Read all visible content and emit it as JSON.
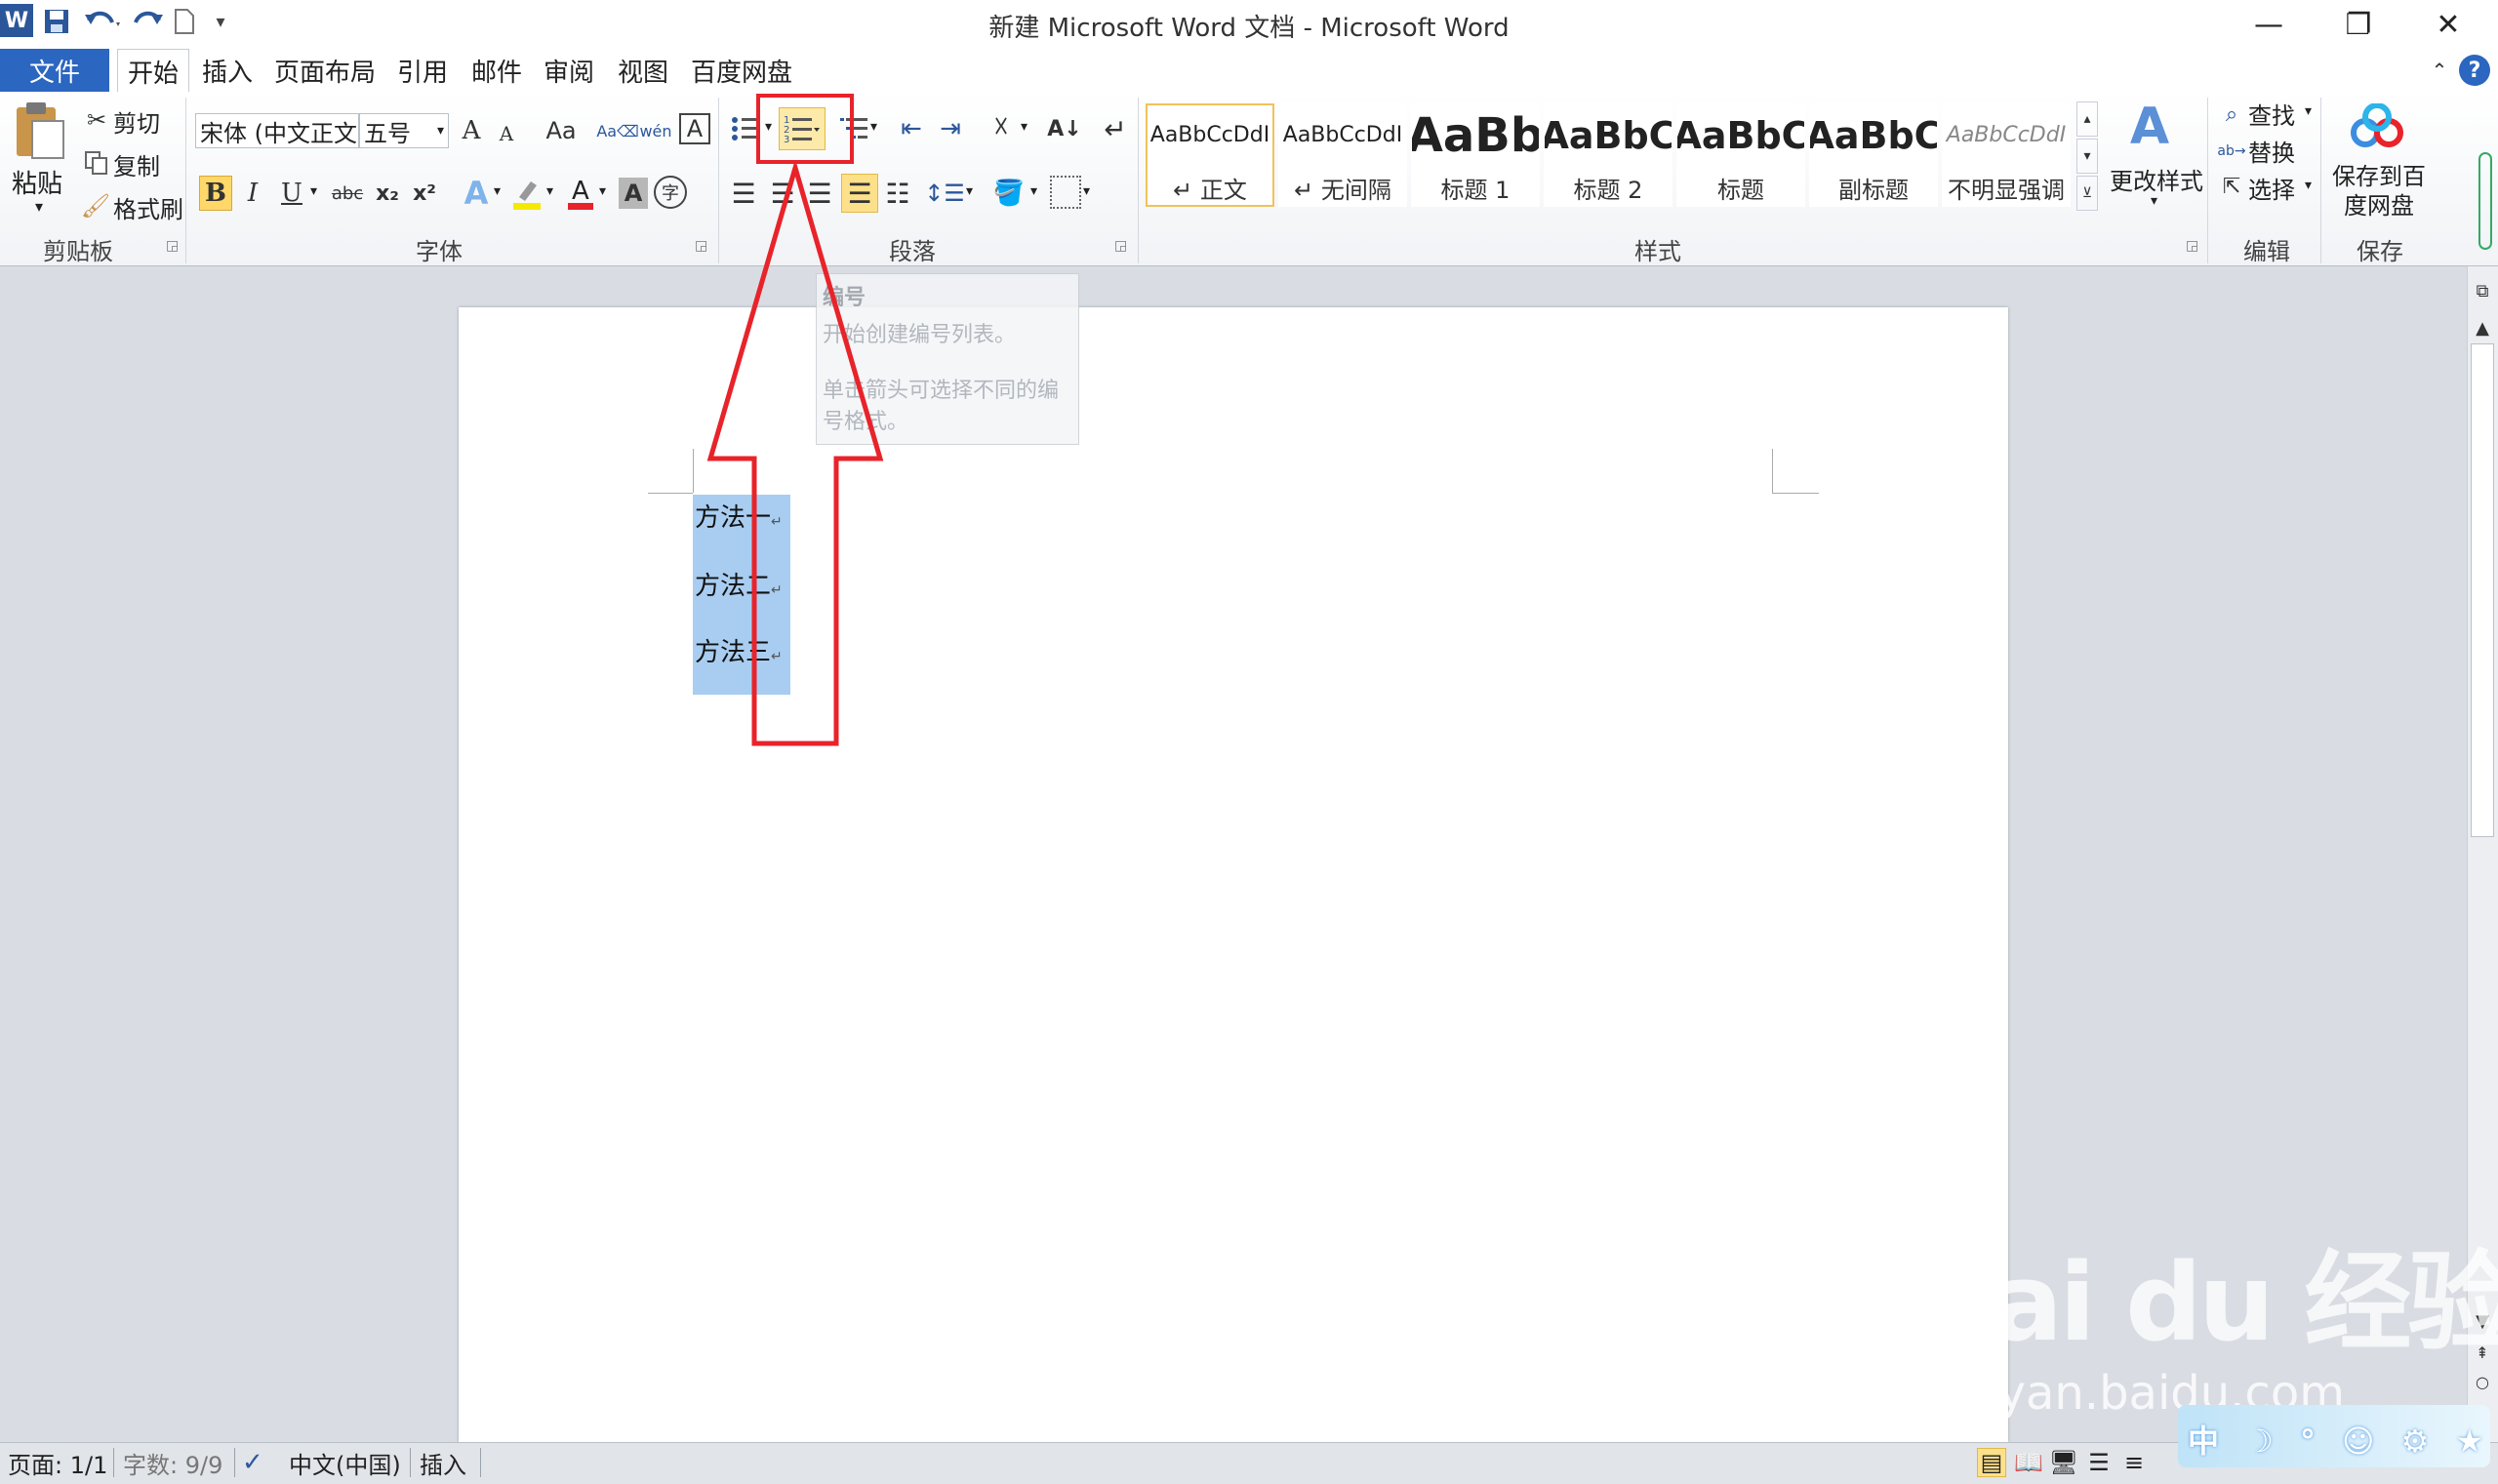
{
  "window": {
    "title": "新建 Microsoft Word 文档 - Microsoft Word",
    "app_icon": "W",
    "minimize": "—",
    "restore": "❐",
    "close": "✕"
  },
  "tabs": [
    "文件",
    "开始",
    "插入",
    "页面布局",
    "引用",
    "邮件",
    "审阅",
    "视图",
    "百度网盘"
  ],
  "clipboard": {
    "paste": "粘贴",
    "cut": "剪切",
    "copy": "复制",
    "format_painter": "格式刷",
    "group": "剪贴板"
  },
  "font": {
    "name": "宋体 (中文正文",
    "size": "五号",
    "group": "字体",
    "grow": "A",
    "shrink": "A",
    "case": "Aa",
    "bold": "B",
    "italic": "I",
    "underline": "U",
    "strike": "abc",
    "subscript": "x₂",
    "superscript": "x²",
    "pinyin": "wén",
    "char_border": "A",
    "effects": "A",
    "shading": "A",
    "circle": "字"
  },
  "paragraph": {
    "group": "段落"
  },
  "styles": {
    "group": "样式",
    "items": [
      {
        "preview": "AaBbCcDdI",
        "name": "↵ 正文"
      },
      {
        "preview": "AaBbCcDdI",
        "name": "↵ 无间隔"
      },
      {
        "preview": "AaBb",
        "name": "标题 1"
      },
      {
        "preview": "AaBbC",
        "name": "标题 2"
      },
      {
        "preview": "AaBbC",
        "name": "标题"
      },
      {
        "preview": "AaBbC",
        "name": "副标题"
      },
      {
        "preview": "AaBbCcDdI",
        "name": "不明显强调"
      }
    ],
    "change": "更改样式"
  },
  "editing": {
    "find": "查找",
    "replace": "替换",
    "select": "选择",
    "group": "编辑"
  },
  "save": {
    "button": "保存到百度网盘",
    "group": "保存"
  },
  "tooltip": {
    "title": "编号",
    "line1": "开始创建编号列表。",
    "line2": "单击箭头可选择不同的编号格式。"
  },
  "document": {
    "lines": [
      "方法一",
      "方法二",
      "方法三"
    ]
  },
  "status": {
    "page": "页面: 1/1",
    "words": "字数: 9/9",
    "language": "中文(中国)",
    "mode": "插入"
  },
  "watermark": {
    "logo": "Bai du 经验",
    "url": "jingyan.baidu.com",
    "ime": "中 ☽ ° ☺ ⚙ ★"
  },
  "colors": {
    "file_tab": "#2b66c0",
    "annotation": "#e8232a",
    "selection": "#a8cdf1",
    "highlight_button": "#ffd869"
  }
}
